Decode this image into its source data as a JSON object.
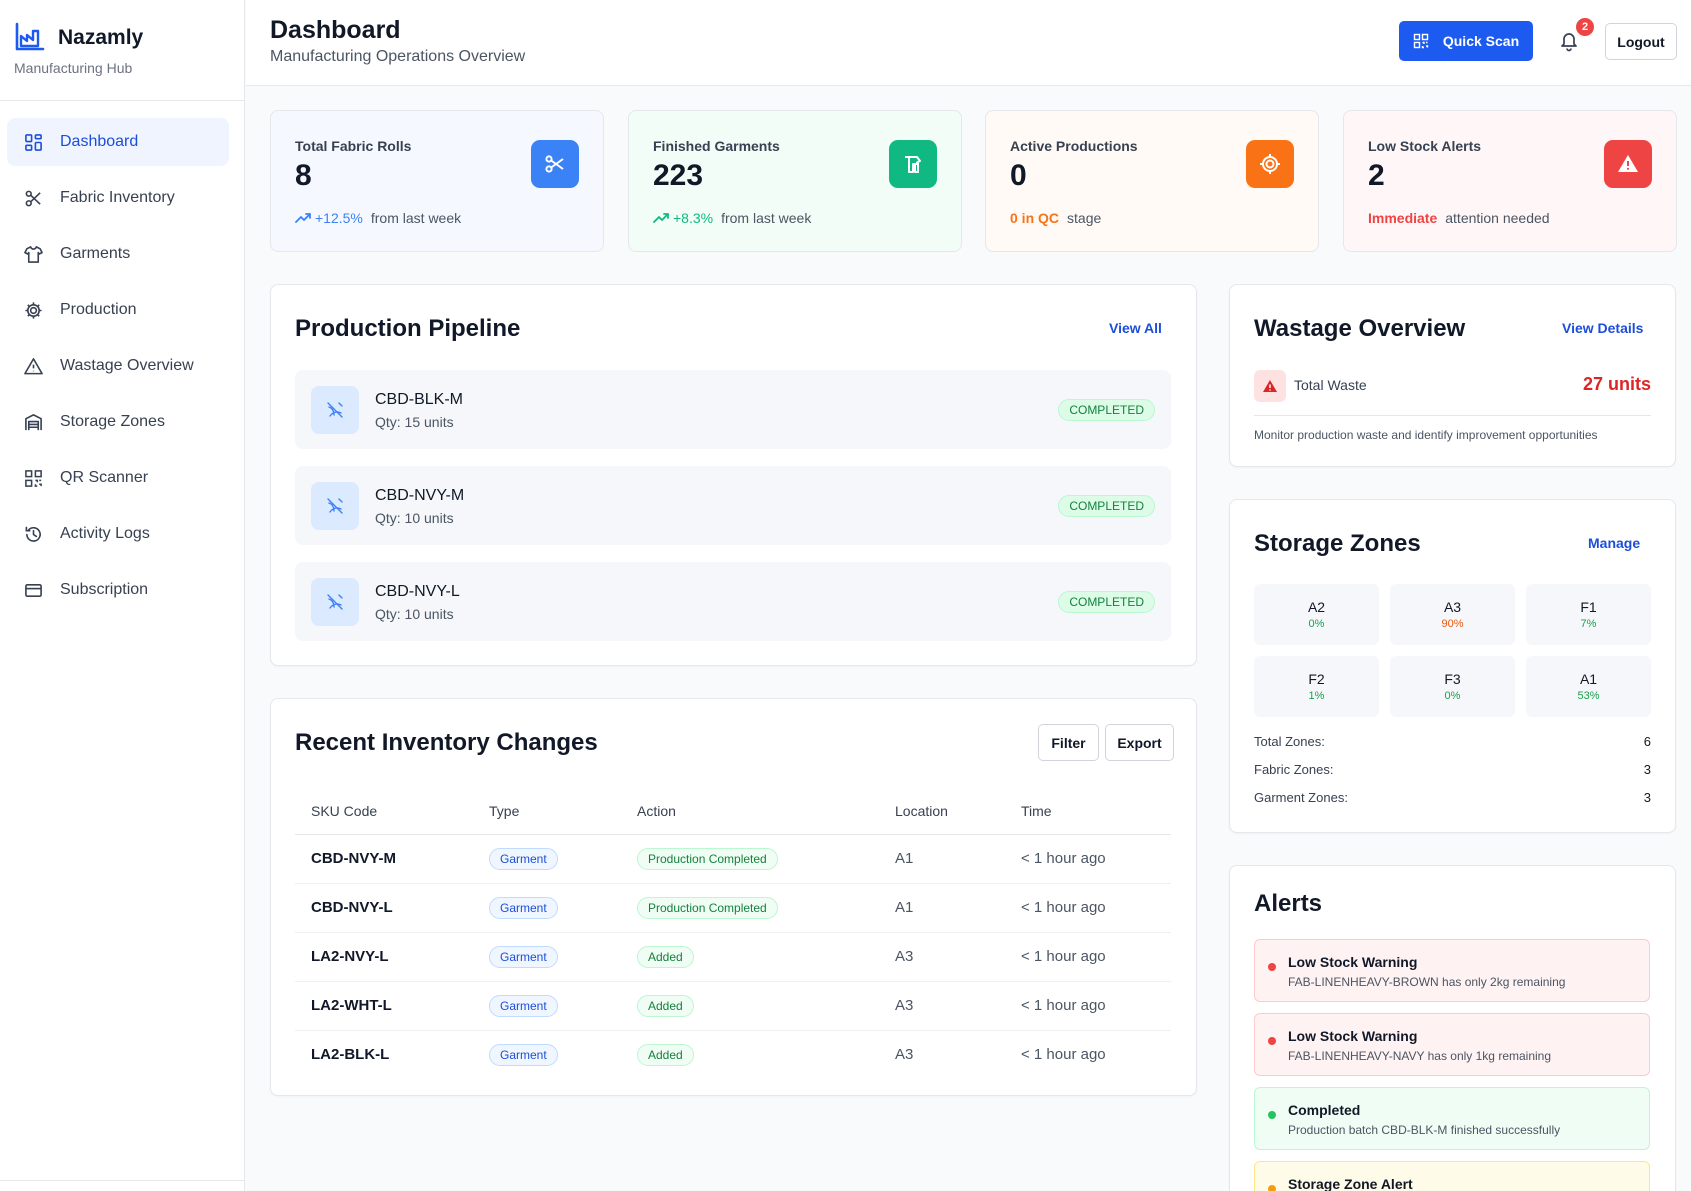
{
  "brand": {
    "name": "Nazamly",
    "subtitle": "Manufacturing Hub"
  },
  "nav": [
    {
      "label": "Dashboard",
      "icon": "dashboard-grid-icon",
      "active": true
    },
    {
      "label": "Fabric Inventory",
      "icon": "scissors-icon"
    },
    {
      "label": "Garments",
      "icon": "shirt-icon"
    },
    {
      "label": "Production",
      "icon": "cog-icon"
    },
    {
      "label": "Wastage Overview",
      "icon": "warning-triangle-icon"
    },
    {
      "label": "Storage Zones",
      "icon": "warehouse-icon"
    },
    {
      "label": "QR Scanner",
      "icon": "qr-code-icon"
    },
    {
      "label": "Activity Logs",
      "icon": "history-icon"
    },
    {
      "label": "Subscription",
      "icon": "credit-card-icon"
    }
  ],
  "header": {
    "title": "Dashboard",
    "subtitle": "Manufacturing Operations Overview",
    "quick_scan": "Quick Scan",
    "notifications": "2",
    "logout": "Logout"
  },
  "stats": [
    {
      "label": "Total Fabric Rolls",
      "value": "8",
      "highlight": "+12.5%",
      "suffix": "from last week",
      "color": "#3b82f6",
      "bg": "#f5f9ff",
      "icon": "scissors-icon"
    },
    {
      "label": "Finished Garments",
      "value": "223",
      "highlight": "+8.3%",
      "suffix": "from last week",
      "color": "#10b981",
      "bg": "#f3fdf7",
      "icon": "garment-icon"
    },
    {
      "label": "Active Productions",
      "value": "0",
      "highlight": "0 in QC",
      "suffix": "stage",
      "color": "#f97316",
      "bg": "#fffaf5",
      "icon": "cog-icon"
    },
    {
      "label": "Low Stock Alerts",
      "value": "2",
      "highlight": "Immediate",
      "suffix": "attention needed",
      "color": "#ef4444",
      "bg": "#fff7f7",
      "icon": "alert-triangle-icon"
    }
  ],
  "pipeline": {
    "title": "Production Pipeline",
    "view_all": "View All",
    "items": [
      {
        "sku": "CBD-BLK-M",
        "qty": "Qty: 15 units",
        "status": "COMPLETED"
      },
      {
        "sku": "CBD-NVY-M",
        "qty": "Qty: 10 units",
        "status": "COMPLETED"
      },
      {
        "sku": "CBD-NVY-L",
        "qty": "Qty: 10 units",
        "status": "COMPLETED"
      }
    ]
  },
  "inventory": {
    "title": "Recent Inventory Changes",
    "filter": "Filter",
    "export": "Export",
    "columns": [
      "SKU Code",
      "Type",
      "Action",
      "Location",
      "Time"
    ],
    "rows": [
      {
        "sku": "CBD-NVY-M",
        "type": "Garment",
        "action": "Production Completed",
        "location": "A1",
        "time": "< 1 hour ago"
      },
      {
        "sku": "CBD-NVY-L",
        "type": "Garment",
        "action": "Production Completed",
        "location": "A1",
        "time": "< 1 hour ago"
      },
      {
        "sku": "LA2-NVY-L",
        "type": "Garment",
        "action": "Added",
        "location": "A3",
        "time": "< 1 hour ago"
      },
      {
        "sku": "LA2-WHT-L",
        "type": "Garment",
        "action": "Added",
        "location": "A3",
        "time": "< 1 hour ago"
      },
      {
        "sku": "LA2-BLK-L",
        "type": "Garment",
        "action": "Added",
        "location": "A3",
        "time": "< 1 hour ago"
      }
    ]
  },
  "wastage": {
    "title": "Wastage Overview",
    "view_details": "View Details",
    "total_label": "Total Waste",
    "total_value": "27 units",
    "note": "Monitor production waste and identify improvement opportunities"
  },
  "storage": {
    "title": "Storage Zones",
    "manage": "Manage",
    "zones": [
      {
        "name": "A2",
        "pct": "0%",
        "color": "#16a34a"
      },
      {
        "name": "A3",
        "pct": "90%",
        "color": "#ea580c"
      },
      {
        "name": "F1",
        "pct": "7%",
        "color": "#16a34a"
      },
      {
        "name": "F2",
        "pct": "1%",
        "color": "#16a34a"
      },
      {
        "name": "F3",
        "pct": "0%",
        "color": "#16a34a"
      },
      {
        "name": "A1",
        "pct": "53%",
        "color": "#16a34a"
      }
    ],
    "summary": [
      {
        "label": "Total Zones:",
        "value": "6"
      },
      {
        "label": "Fabric Zones:",
        "value": "3"
      },
      {
        "label": "Garment Zones:",
        "value": "3"
      }
    ]
  },
  "alerts": {
    "title": "Alerts",
    "items": [
      {
        "title": "Low Stock Warning",
        "text": "FAB-LINENHEAVY-BROWN has only 2kg remaining",
        "kind": "danger"
      },
      {
        "title": "Low Stock Warning",
        "text": "FAB-LINENHEAVY-NAVY has only 1kg remaining",
        "kind": "danger"
      },
      {
        "title": "Completed",
        "text": "Production batch CBD-BLK-M finished successfully",
        "kind": "success"
      },
      {
        "title": "Storage Zone Alert",
        "text": "",
        "kind": "warning"
      }
    ]
  }
}
